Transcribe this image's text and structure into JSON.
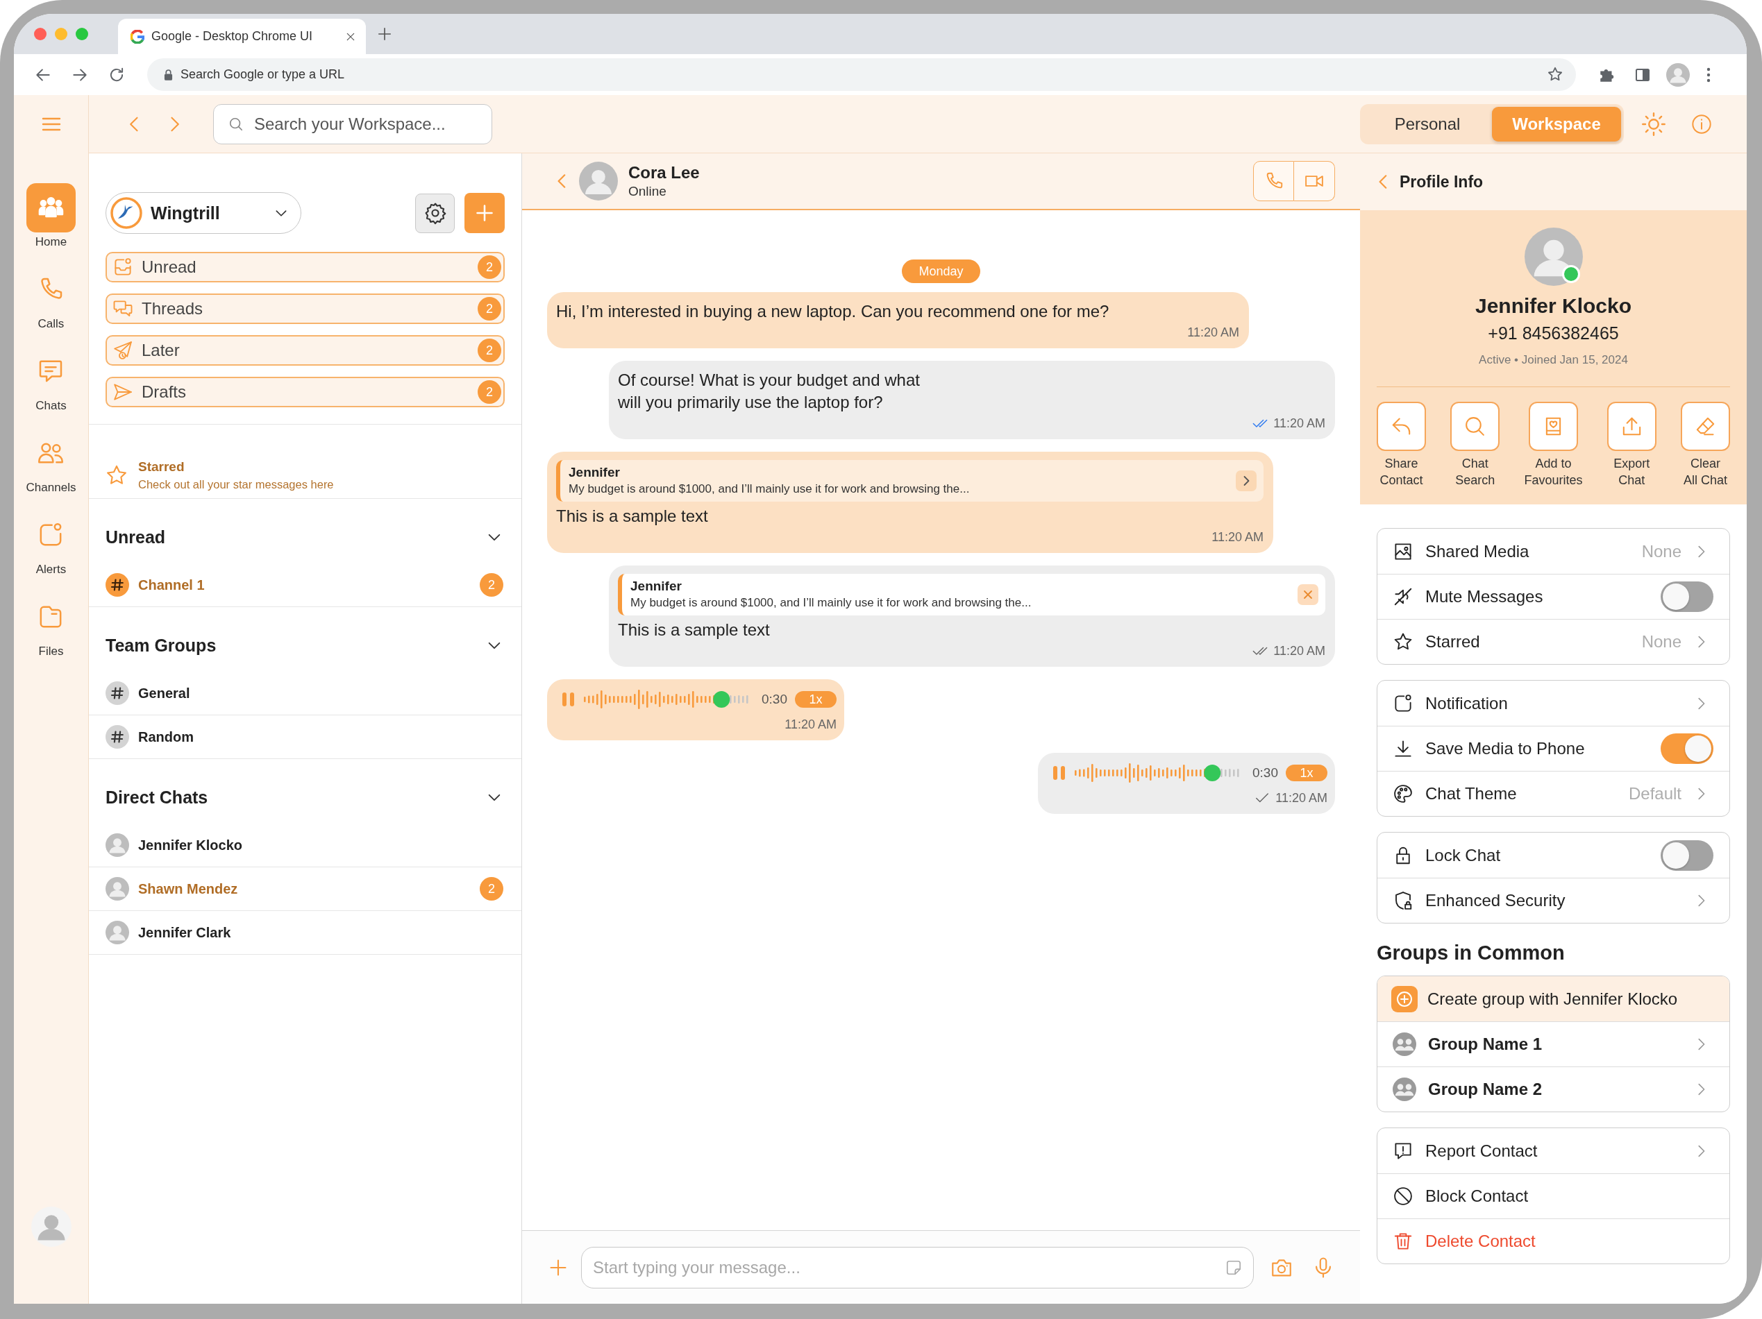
{
  "browser": {
    "tab_title": "Google - Desktop Chrome UI",
    "address_bar": {
      "placeholder": "Search Google or type a URL"
    }
  },
  "topbar": {
    "search": {
      "placeholder": "Search your Workspace..."
    },
    "modes": [
      {
        "label": "Personal",
        "selected": false
      },
      {
        "label": "Workspace",
        "selected": true
      }
    ]
  },
  "rail": {
    "items": [
      {
        "label": "Home",
        "selected": true
      },
      {
        "label": "Calls",
        "selected": false
      },
      {
        "label": "Chats",
        "selected": false
      },
      {
        "label": "Channels",
        "selected": false
      },
      {
        "label": "Alerts",
        "selected": false
      },
      {
        "label": "Files",
        "selected": false
      }
    ]
  },
  "sidebar": {
    "workspace": "Wingtrill",
    "folders": [
      {
        "label": "Unread",
        "count": "2"
      },
      {
        "label": "Threads",
        "count": "2"
      },
      {
        "label": "Later",
        "count": "2"
      },
      {
        "label": "Drafts",
        "count": "2"
      }
    ],
    "starred": {
      "title": "Starred",
      "subtitle": "Check out all your star messages here"
    },
    "sections": [
      {
        "title": "Unread",
        "expanded": true,
        "items": [
          {
            "kind": "channel",
            "name": "Channel 1",
            "unread": true,
            "count": "2"
          }
        ]
      },
      {
        "title": "Team Groups",
        "expanded": true,
        "items": [
          {
            "kind": "channel",
            "name": "General",
            "unread": false
          },
          {
            "kind": "channel",
            "name": "Random",
            "unread": false
          }
        ]
      },
      {
        "title": "Direct Chats",
        "expanded": true,
        "items": [
          {
            "kind": "person",
            "name": "Jennifer Klocko",
            "unread": false
          },
          {
            "kind": "person",
            "name": "Shawn Mendez",
            "unread": true,
            "count": "2"
          },
          {
            "kind": "person",
            "name": "Jennifer Clark",
            "unread": false
          }
        ]
      }
    ]
  },
  "chat": {
    "contact": {
      "name": "Cora Lee",
      "status": "Online"
    },
    "date_label": "Monday",
    "messages": [
      {
        "kind": "text",
        "outgoing": false,
        "text": "Hi, I’m interested in buying a new laptop. Can you recommend one for me?",
        "time": "11:20 AM"
      },
      {
        "kind": "text",
        "outgoing": true,
        "text": "Of course! What is your budget and what\nwill you primarily use the laptop for?",
        "time": "11:20 AM",
        "delivered": true,
        "read": true
      },
      {
        "kind": "reply",
        "outgoing": false,
        "quote": {
          "author": "Jennifer",
          "text": "My budget is around $1000, and I’ll mainly use it for work and browsing the..."
        },
        "text": "This is a sample text",
        "time": "11:20 AM"
      },
      {
        "kind": "reply",
        "outgoing": true,
        "quote": {
          "author": "Jennifer",
          "text": "My budget is around $1000, and I’ll mainly use it for work and browsing the..."
        },
        "text": "This is a sample text",
        "time": "11:20 AM",
        "delivered": true,
        "read": false
      },
      {
        "kind": "voice",
        "outgoing": false,
        "playing": true,
        "level": 0.82,
        "duration": "0:30",
        "speed": "1x",
        "time": "11:20 AM"
      },
      {
        "kind": "voice",
        "outgoing": true,
        "playing": true,
        "level": 0.82,
        "duration": "0:30",
        "speed": "1x",
        "time": "11:20 AM",
        "delivered": false,
        "read": false
      }
    ],
    "composer": {
      "placeholder": "Start typing your message..."
    }
  },
  "profile": {
    "title": "Profile Info",
    "name": "Jennifer Klocko",
    "phone": "+91 8456382465",
    "online": true,
    "status_line": "Active • Joined Jan 15, 2024",
    "actions": [
      {
        "label": "Share\nContact"
      },
      {
        "label": "Chat\nSearch"
      },
      {
        "label": "Add to\nFavourites"
      },
      {
        "label": "Export\nChat"
      },
      {
        "label": "Clear\nAll Chat"
      }
    ],
    "setting_groups": [
      {
        "rows": [
          {
            "kind": "link",
            "label": "Shared Media",
            "value": "None"
          },
          {
            "kind": "toggle",
            "label": "Mute Messages",
            "on": false
          },
          {
            "kind": "link",
            "label": "Starred",
            "value": "None"
          }
        ]
      },
      {
        "rows": [
          {
            "kind": "link",
            "label": "Notification"
          },
          {
            "kind": "toggle",
            "label": "Save Media to Phone",
            "on": true
          },
          {
            "kind": "link",
            "label": "Chat Theme",
            "value": "Default"
          }
        ]
      },
      {
        "rows": [
          {
            "kind": "toggle",
            "label": "Lock Chat",
            "on": false
          },
          {
            "kind": "link",
            "label": "Enhanced Security"
          }
        ]
      }
    ],
    "groups_in_common": {
      "title": "Groups in Common",
      "create_label": "Create group with Jennifer Klocko",
      "groups": [
        {
          "name": "Group Name 1"
        },
        {
          "name": "Group Name 2"
        }
      ]
    },
    "contact_actions": [
      {
        "kind": "link",
        "label": "Report Contact"
      },
      {
        "kind": "action",
        "label": "Block Contact"
      },
      {
        "kind": "destructive",
        "label": "Delete Contact"
      }
    ]
  }
}
